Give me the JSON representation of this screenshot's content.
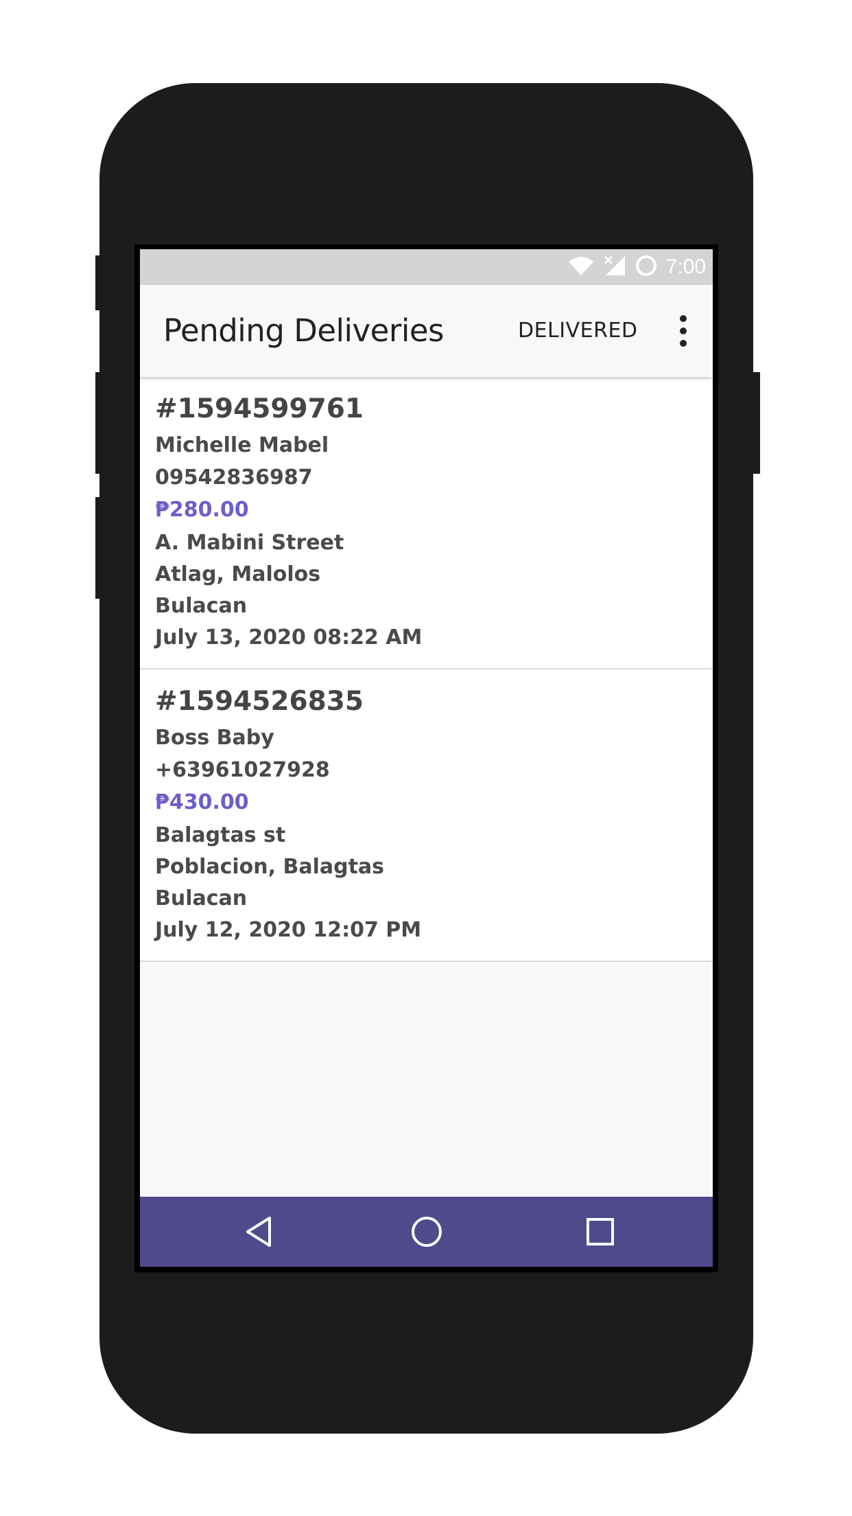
{
  "status_bar": {
    "time": "7:00",
    "icons": [
      "wifi-icon",
      "cell-signal-icon",
      "battery-icon"
    ]
  },
  "app_bar": {
    "title": "Pending Deliveries",
    "action_label": "DELIVERED",
    "overflow_icon": "more-vertical-icon"
  },
  "orders": [
    {
      "id": "#1594599761",
      "customer": "Michelle Mabel",
      "phone": "09542836987",
      "amount": "₱280.00",
      "street": "A. Mabini Street",
      "barangay_city": "Atlag, Malolos",
      "province": "Bulacan",
      "datetime": "July 13, 2020 08:22 AM"
    },
    {
      "id": "#1594526835",
      "customer": "Boss Baby",
      "phone": "+63961027928",
      "amount": "₱430.00",
      "street": "Balagtas st",
      "barangay_city": "Poblacion, Balagtas",
      "province": "Bulacan",
      "datetime": "July 12, 2020 12:07 PM"
    }
  ],
  "nav_bar": {
    "buttons": [
      "back-icon",
      "home-icon",
      "recents-icon"
    ]
  },
  "colors": {
    "accent": "#6b5fc7",
    "nav_bar": "#4f4a8c",
    "status_bar": "#d4d4d4",
    "device_frame": "#1c1c1c"
  }
}
